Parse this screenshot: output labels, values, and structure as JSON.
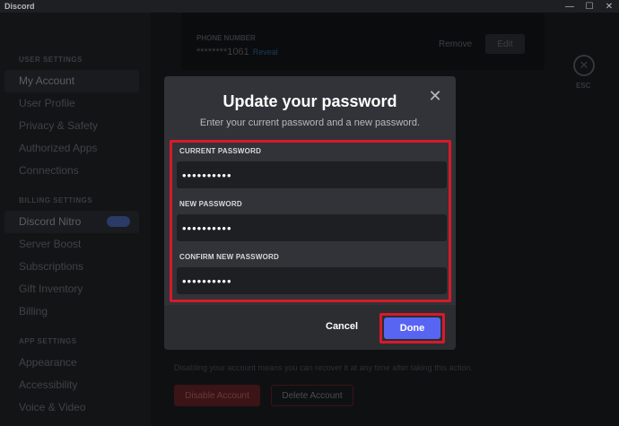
{
  "window": {
    "title": "Discord",
    "controls": [
      "—",
      "☐",
      "✕"
    ]
  },
  "sidebar": {
    "user_settings_header": "USER SETTINGS",
    "user_items": [
      "My Account",
      "User Profile",
      "Privacy & Safety",
      "Authorized Apps",
      "Connections"
    ],
    "billing_header": "BILLING SETTINGS",
    "billing_items": [
      "Discord Nitro",
      "Server Boost",
      "Subscriptions",
      "Gift Inventory",
      "Billing"
    ],
    "app_header": "APP SETTINGS",
    "app_items": [
      "Appearance",
      "Accessibility",
      "Voice & Video"
    ]
  },
  "background": {
    "phone_label": "PHONE NUMBER",
    "phone_value": "********1061",
    "reveal_label": "Reveal",
    "remove_label": "Remove",
    "edit_label": "Edit",
    "esc_label": "ESC",
    "disable_note": "Disabling your account means you can recover it at any time after taking this action.",
    "disable_label": "Disable Account",
    "delete_label": "Delete Account"
  },
  "modal": {
    "title": "Update your password",
    "subtitle": "Enter your current password and a new password.",
    "close_icon": "close-icon",
    "fields": [
      {
        "label": "CURRENT PASSWORD",
        "value": "••••••••••"
      },
      {
        "label": "NEW PASSWORD",
        "value": "••••••••••"
      },
      {
        "label": "CONFIRM NEW PASSWORD",
        "value": "••••••••••"
      }
    ],
    "cancel_label": "Cancel",
    "done_label": "Done"
  },
  "colors": {
    "accent": "#5865f2",
    "highlight": "#d71a2a",
    "modal_bg": "#313338",
    "input_bg": "#1e1f22"
  }
}
